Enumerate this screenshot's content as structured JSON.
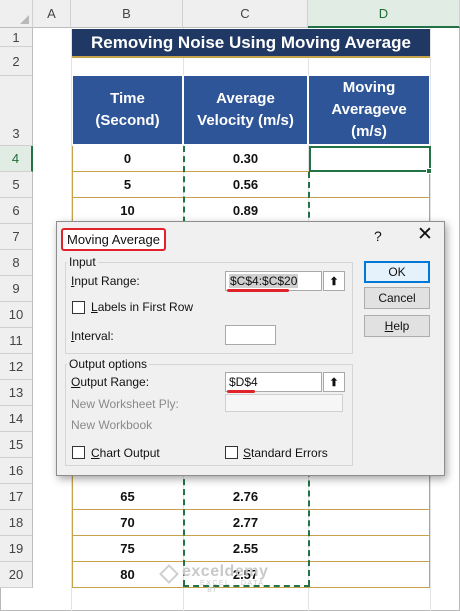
{
  "columns": [
    {
      "label": "A",
      "selected": false
    },
    {
      "label": "B",
      "selected": false
    },
    {
      "label": "C",
      "selected": false
    },
    {
      "label": "D",
      "selected": true
    }
  ],
  "rows": [
    {
      "label": "1",
      "selected": false
    },
    {
      "label": "2",
      "selected": false
    },
    {
      "label": "3",
      "selected": false
    },
    {
      "label": "4",
      "selected": true
    },
    {
      "label": "5",
      "selected": false
    },
    {
      "label": "6",
      "selected": false
    },
    {
      "label": "7",
      "selected": false
    },
    {
      "label": "8",
      "selected": false
    },
    {
      "label": "9",
      "selected": false
    },
    {
      "label": "10",
      "selected": false
    },
    {
      "label": "11",
      "selected": false
    },
    {
      "label": "12",
      "selected": false
    },
    {
      "label": "13",
      "selected": false
    },
    {
      "label": "14",
      "selected": false
    },
    {
      "label": "15",
      "selected": false
    },
    {
      "label": "16",
      "selected": false
    },
    {
      "label": "17",
      "selected": false
    },
    {
      "label": "18",
      "selected": false
    },
    {
      "label": "19",
      "selected": false
    },
    {
      "label": "20",
      "selected": false
    }
  ],
  "sheet": {
    "title": "Removing Noise Using Moving Average",
    "headers": {
      "time": [
        "Time",
        "(Second)"
      ],
      "velocity": [
        "Average",
        "Velocity (m/s)"
      ],
      "moving": [
        "Moving",
        "Averageve",
        "(m/s)"
      ]
    },
    "data_top": [
      {
        "time": "0",
        "velocity": "0.30"
      },
      {
        "time": "5",
        "velocity": "0.56"
      },
      {
        "time": "10",
        "velocity": "0.89"
      }
    ],
    "data_bottom": [
      {
        "time": "65",
        "velocity": "2.76"
      },
      {
        "time": "70",
        "velocity": "2.77"
      },
      {
        "time": "75",
        "velocity": "2.55"
      },
      {
        "time": "80",
        "velocity": "2.57"
      }
    ],
    "colors": {
      "header_bg": "#2e5597",
      "title_bg": "#203864",
      "selection": "#217346",
      "border_gold": "#c8a24a"
    }
  },
  "watermark": {
    "name": "exceldemy",
    "tagline": "EXCEL · DATA · BI"
  },
  "dialog": {
    "title": "Moving Average",
    "help_glyph": "?",
    "close_glyph": "✕",
    "input_group": "Input",
    "input_range_label": "Input Range:",
    "input_range_value": "$C$4:$C$20",
    "labels_first_row": "Labels in First Row",
    "interval_label": "Interval:",
    "interval_value": "",
    "output_group": "Output options",
    "output_range_label": "Output Range:",
    "output_range_value": "$D$4",
    "new_ws_ply": "New Worksheet Ply:",
    "new_workbook": "New Workbook",
    "chart_output": "Chart Output",
    "standard_errors": "Standard Errors",
    "ref_glyph": "⬆",
    "buttons": {
      "ok": "OK",
      "cancel": "Cancel",
      "help": "Help"
    }
  }
}
